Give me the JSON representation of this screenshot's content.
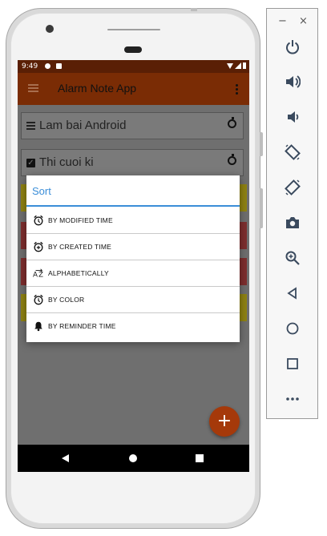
{
  "status_bar": {
    "time": "9:49"
  },
  "app": {
    "title": "Alarm Note App"
  },
  "notes": [
    {
      "title": "Lam bai Android",
      "icon": "lines-icon"
    },
    {
      "title": "Thi cuoi ki",
      "icon": "checkbox-icon"
    }
  ],
  "dialog": {
    "title": "Sort",
    "options": [
      {
        "label": "BY MODIFIED TIME",
        "icon": "alarm-clock-icon"
      },
      {
        "label": "BY CREATED TIME",
        "icon": "alarm-add-icon"
      },
      {
        "label": "ALPHABETICALLY",
        "icon": "sort-az-icon"
      },
      {
        "label": "BY COLOR",
        "icon": "alarm-clock-icon"
      },
      {
        "label": "BY REMINDER TIME",
        "icon": "bell-icon"
      }
    ]
  },
  "fab": {
    "label": "+"
  },
  "colors": {
    "app_bar": "#7a2c05",
    "status_bar": "#5a1f05",
    "accent": "#3b8ed8",
    "fab": "#a5390a",
    "band_yellow": "#8f8212",
    "band_red": "#7e2e2e"
  },
  "emulator_panel": {
    "window_controls": [
      "−",
      "×"
    ],
    "buttons": [
      "power",
      "volume-up",
      "volume-down",
      "rotate-left",
      "rotate-right",
      "screenshot",
      "zoom",
      "back",
      "home",
      "overview",
      "more"
    ]
  }
}
